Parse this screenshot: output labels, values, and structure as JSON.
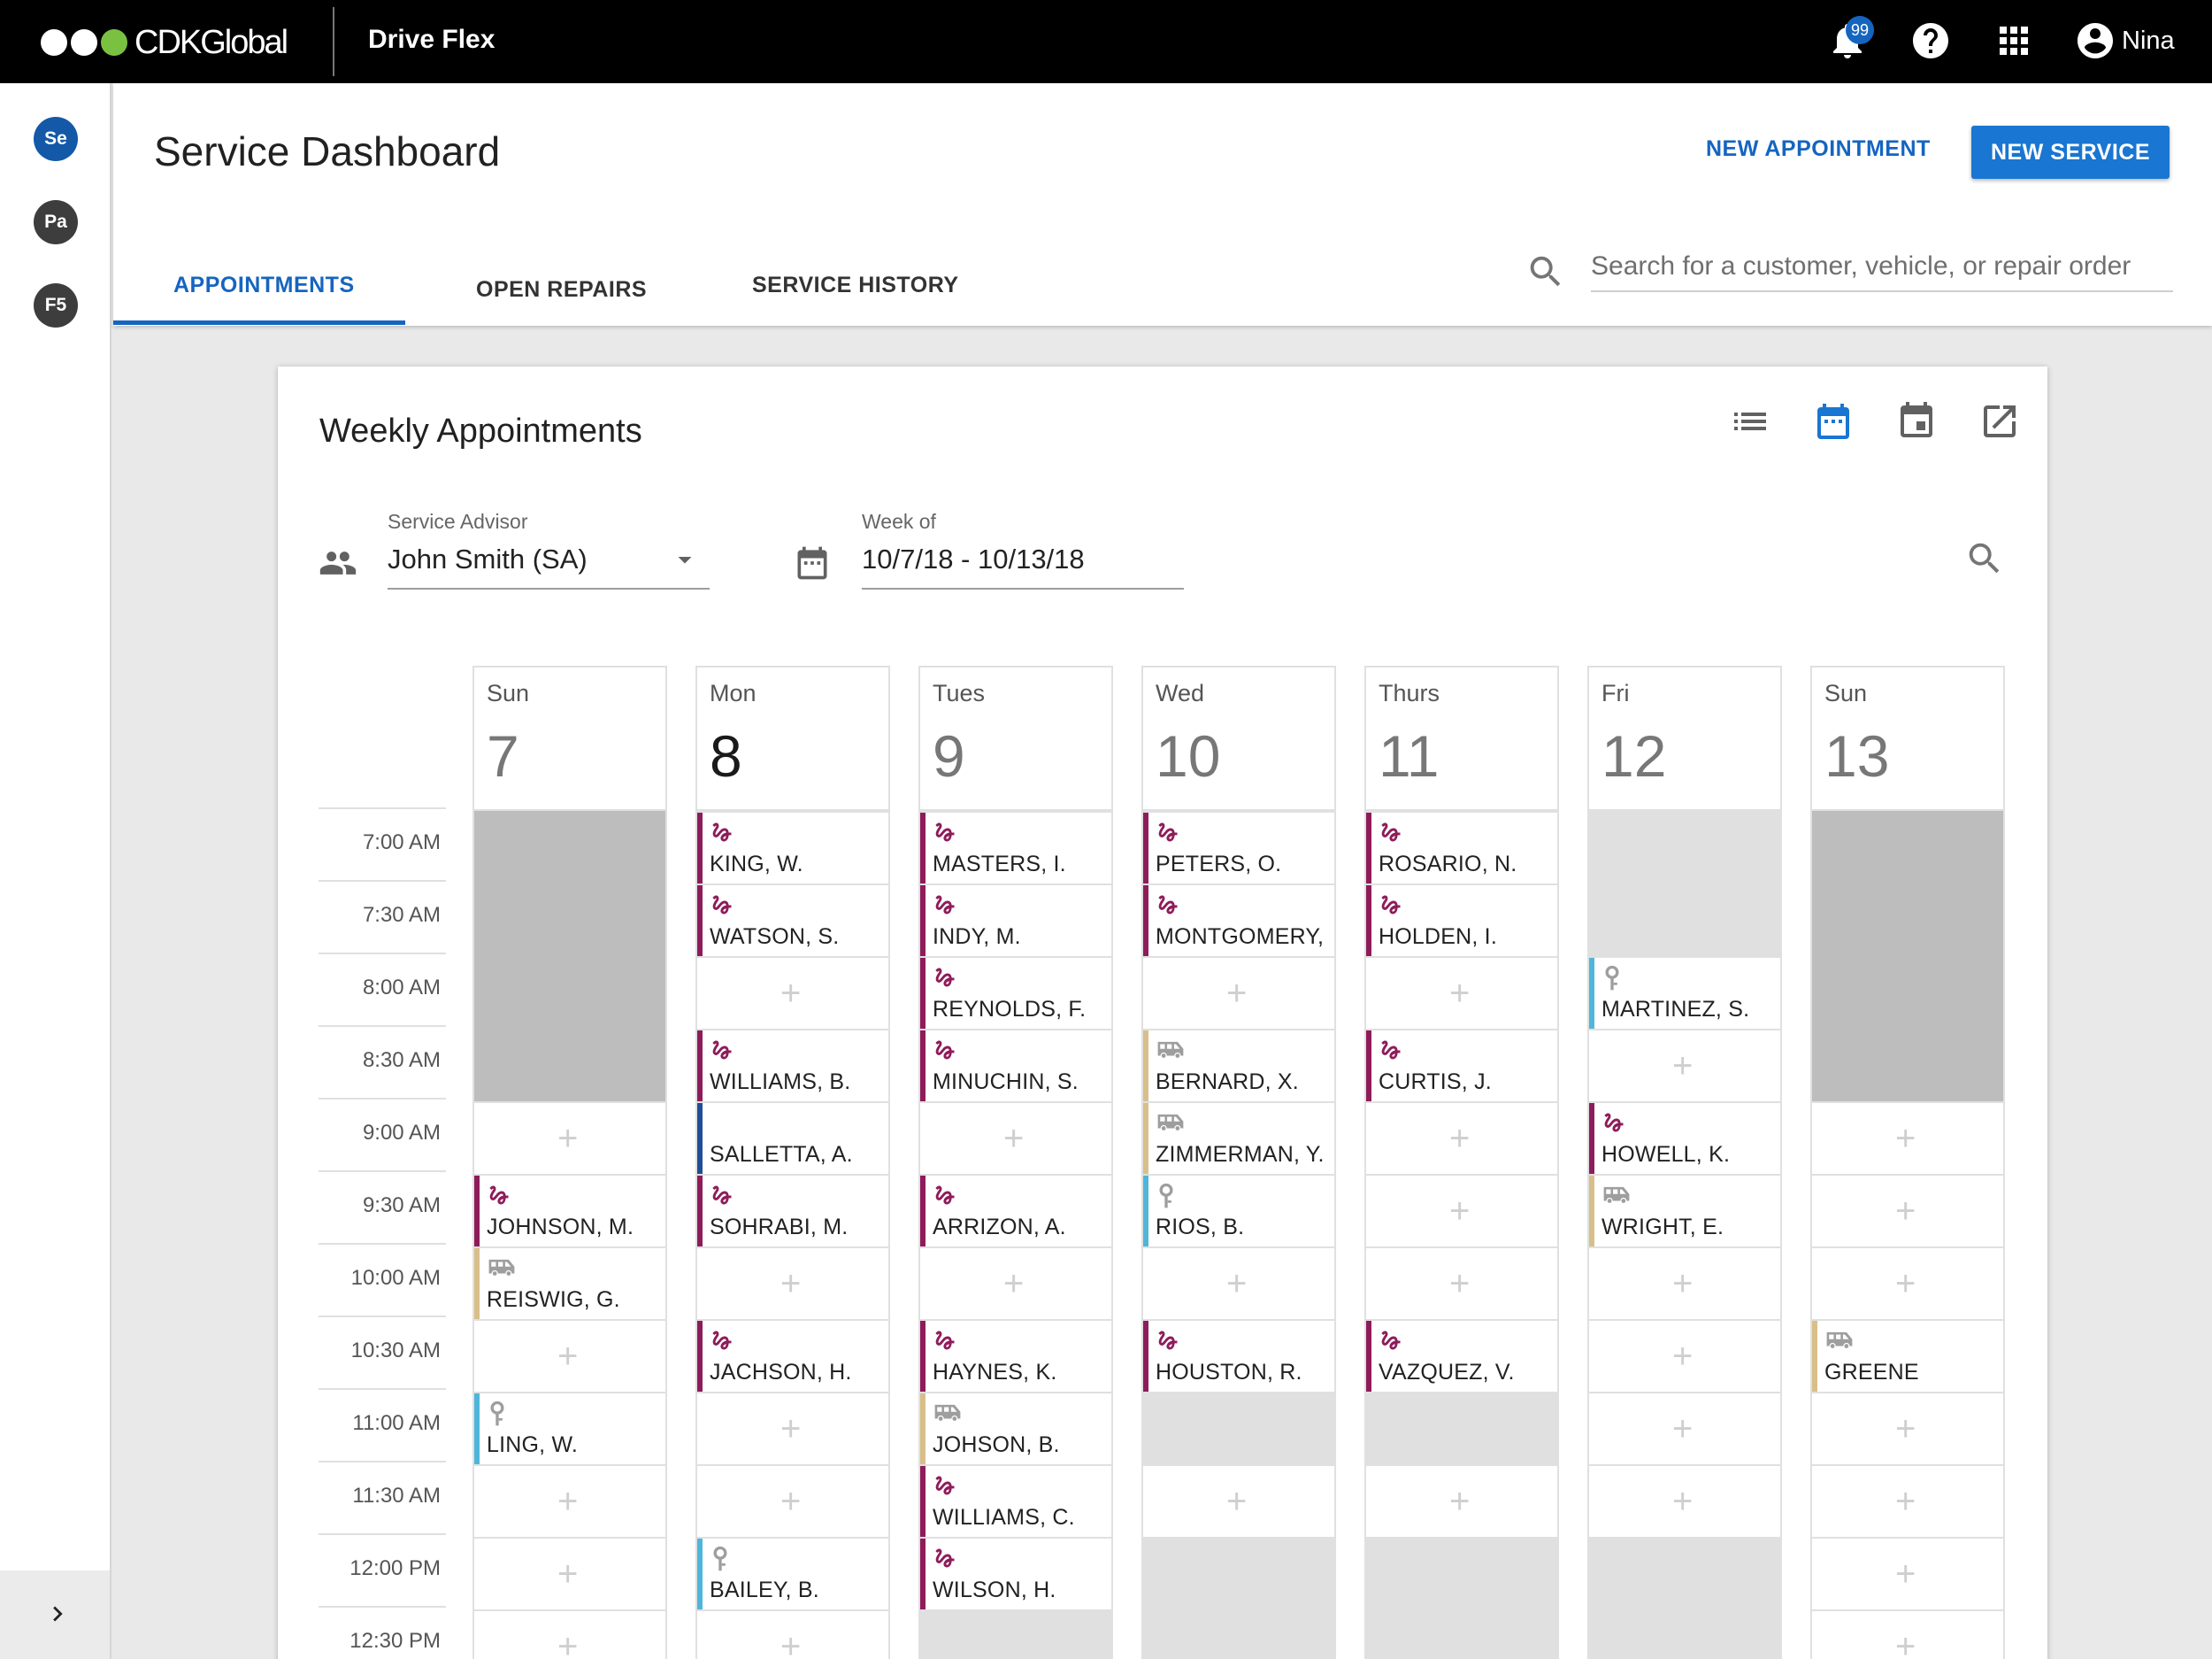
{
  "brand": {
    "name": "CDKGlobal",
    "app": "Drive Flex"
  },
  "topbar": {
    "notification_count": "99",
    "user": "Nina"
  },
  "rail": {
    "items": [
      "Se",
      "Pa",
      "F5"
    ]
  },
  "header": {
    "title": "Service Dashboard",
    "new_appointment": "NEW APPOINTMENT",
    "new_service": "NEW SERVICE",
    "tabs": [
      "APPOINTMENTS",
      "OPEN REPAIRS",
      "SERVICE HISTORY"
    ],
    "search_placeholder": "Search for a customer, vehicle, or repair order"
  },
  "card": {
    "title": "Weekly Appointments",
    "advisor_label": "Service Advisor",
    "advisor_value": "John Smith (SA)",
    "week_label": "Week of",
    "week_value": "10/7/18 - 10/13/18"
  },
  "colors": {
    "waiter": "#8e1c5a",
    "shuttle": "#d8bf8a",
    "dropoff": "#4fb6d9",
    "other": "#1f4e96",
    "accent": "#1565c0"
  },
  "times": [
    "7:00 AM",
    "7:30 AM",
    "8:00 AM",
    "8:30 AM",
    "9:00 AM",
    "9:30 AM",
    "10:00 AM",
    "10:30 AM",
    "11:00 AM",
    "11:30 AM",
    "12:00 PM",
    "12:30 PM"
  ],
  "days": [
    {
      "name": "Sun",
      "num": "7",
      "today": false,
      "slots": [
        {
          "type": "gray"
        },
        {
          "type": "gray"
        },
        {
          "type": "gray"
        },
        {
          "type": "gray"
        },
        {
          "type": "empty"
        },
        {
          "type": "appt",
          "kind": "waiter",
          "name": "JOHNSON, M."
        },
        {
          "type": "appt",
          "kind": "shuttle",
          "name": "REISWIG, G."
        },
        {
          "type": "empty"
        },
        {
          "type": "appt",
          "kind": "dropoff",
          "name": "LING, W."
        },
        {
          "type": "empty"
        },
        {
          "type": "empty"
        },
        {
          "type": "empty"
        }
      ]
    },
    {
      "name": "Mon",
      "num": "8",
      "today": true,
      "slots": [
        {
          "type": "appt",
          "kind": "waiter",
          "name": "KING, W."
        },
        {
          "type": "appt",
          "kind": "waiter",
          "name": "WATSON, S."
        },
        {
          "type": "empty"
        },
        {
          "type": "appt",
          "kind": "waiter",
          "name": "WILLIAMS, B."
        },
        {
          "type": "appt",
          "kind": "other",
          "name": "SALLETTA, A."
        },
        {
          "type": "appt",
          "kind": "waiter",
          "name": "SOHRABI, M."
        },
        {
          "type": "empty"
        },
        {
          "type": "appt",
          "kind": "waiter",
          "name": "JACHSON, H."
        },
        {
          "type": "empty"
        },
        {
          "type": "empty"
        },
        {
          "type": "appt",
          "kind": "dropoff",
          "name": "BAILEY, B."
        },
        {
          "type": "empty"
        }
      ]
    },
    {
      "name": "Tues",
      "num": "9",
      "today": false,
      "slots": [
        {
          "type": "appt",
          "kind": "waiter",
          "name": "MASTERS, I."
        },
        {
          "type": "appt",
          "kind": "waiter",
          "name": "INDY, M."
        },
        {
          "type": "appt",
          "kind": "waiter",
          "name": "REYNOLDS, F."
        },
        {
          "type": "appt",
          "kind": "waiter",
          "name": "MINUCHIN, S."
        },
        {
          "type": "empty"
        },
        {
          "type": "appt",
          "kind": "waiter",
          "name": "ARRIZON, A."
        },
        {
          "type": "empty"
        },
        {
          "type": "appt",
          "kind": "waiter",
          "name": "HAYNES, K."
        },
        {
          "type": "appt",
          "kind": "shuttle",
          "name": "JOHSON, B."
        },
        {
          "type": "appt",
          "kind": "waiter",
          "name": "WILLIAMS, C."
        },
        {
          "type": "appt",
          "kind": "waiter",
          "name": "WILSON, H."
        },
        {
          "type": "lgray"
        }
      ]
    },
    {
      "name": "Wed",
      "num": "10",
      "today": false,
      "slots": [
        {
          "type": "appt",
          "kind": "waiter",
          "name": "PETERS, O."
        },
        {
          "type": "appt",
          "kind": "waiter",
          "name": "MONTGOMERY,"
        },
        {
          "type": "empty"
        },
        {
          "type": "appt",
          "kind": "shuttle",
          "name": "BERNARD, X."
        },
        {
          "type": "appt",
          "kind": "shuttle",
          "name": "ZIMMERMAN, Y."
        },
        {
          "type": "appt",
          "kind": "dropoff",
          "name": "RIOS, B."
        },
        {
          "type": "empty"
        },
        {
          "type": "appt",
          "kind": "waiter",
          "name": "HOUSTON, R."
        },
        {
          "type": "lgray"
        },
        {
          "type": "empty"
        },
        {
          "type": "lgray"
        },
        {
          "type": "lgray"
        }
      ]
    },
    {
      "name": "Thurs",
      "num": "11",
      "today": false,
      "slots": [
        {
          "type": "appt",
          "kind": "waiter",
          "name": "ROSARIO, N."
        },
        {
          "type": "appt",
          "kind": "waiter",
          "name": "HOLDEN, I."
        },
        {
          "type": "empty"
        },
        {
          "type": "appt",
          "kind": "waiter",
          "name": "CURTIS, J."
        },
        {
          "type": "empty"
        },
        {
          "type": "empty"
        },
        {
          "type": "empty"
        },
        {
          "type": "appt",
          "kind": "waiter",
          "name": "VAZQUEZ, V."
        },
        {
          "type": "lgray"
        },
        {
          "type": "empty"
        },
        {
          "type": "lgray"
        },
        {
          "type": "lgray"
        }
      ]
    },
    {
      "name": "Fri",
      "num": "12",
      "today": false,
      "slots": [
        {
          "type": "lgray"
        },
        {
          "type": "lgray"
        },
        {
          "type": "appt",
          "kind": "dropoff",
          "name": "MARTINEZ, S."
        },
        {
          "type": "empty"
        },
        {
          "type": "appt",
          "kind": "waiter",
          "name": "HOWELL, K."
        },
        {
          "type": "appt",
          "kind": "shuttle",
          "name": "WRIGHT, E."
        },
        {
          "type": "empty"
        },
        {
          "type": "empty"
        },
        {
          "type": "empty"
        },
        {
          "type": "empty"
        },
        {
          "type": "lgray"
        },
        {
          "type": "lgray"
        }
      ]
    },
    {
      "name": "Sun",
      "num": "13",
      "today": false,
      "slots": [
        {
          "type": "gray"
        },
        {
          "type": "gray"
        },
        {
          "type": "gray"
        },
        {
          "type": "gray"
        },
        {
          "type": "empty"
        },
        {
          "type": "empty"
        },
        {
          "type": "empty"
        },
        {
          "type": "appt",
          "kind": "shuttle",
          "name": "GREENE"
        },
        {
          "type": "empty"
        },
        {
          "type": "empty"
        },
        {
          "type": "empty"
        },
        {
          "type": "empty"
        }
      ]
    }
  ]
}
